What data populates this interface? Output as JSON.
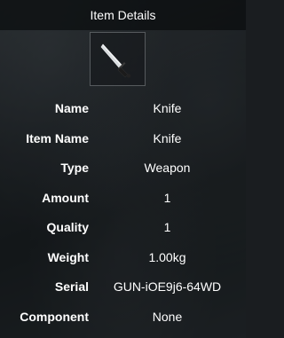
{
  "header": {
    "title": "Item Details"
  },
  "item": {
    "icon": "knife-icon"
  },
  "rows": [
    {
      "label": "Name",
      "value": "Knife"
    },
    {
      "label": "Item Name",
      "value": "Knife"
    },
    {
      "label": "Type",
      "value": "Weapon"
    },
    {
      "label": "Amount",
      "value": "1"
    },
    {
      "label": "Quality",
      "value": "1"
    },
    {
      "label": "Weight",
      "value": "1.00kg"
    },
    {
      "label": "Serial",
      "value": "GUN-iOE9j6-64WD"
    },
    {
      "label": "Component",
      "value": "None"
    }
  ]
}
